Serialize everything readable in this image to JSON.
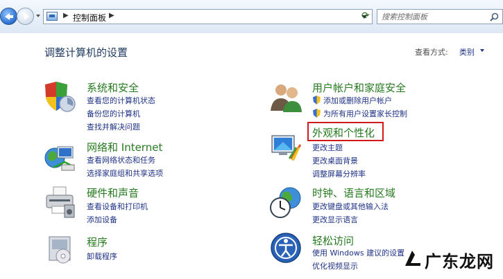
{
  "nav": {
    "breadcrumb": "控制面板",
    "search_placeholder": "搜索控制面板"
  },
  "header": {
    "title": "调整计算机的设置",
    "view_by_label": "查看方式:",
    "view_by_value": "类别"
  },
  "categories": [
    {
      "title": "系统和安全",
      "icon": "shield-icon",
      "links": [
        "查看您的计算机状态",
        "备份您的计算机",
        "查找并解决问题"
      ]
    },
    {
      "title": "网络和 Internet",
      "icon": "network-globe-icon",
      "links": [
        "查看网络状态和任务",
        "选择家庭组和共享选项"
      ]
    },
    {
      "title": "硬件和声音",
      "icon": "printer-icon",
      "links": [
        "查看设备和打印机",
        "添加设备"
      ]
    },
    {
      "title": "程序",
      "icon": "programs-box-icon",
      "links": [
        "卸载程序"
      ]
    },
    {
      "title": "用户帐户和家庭安全",
      "icon": "users-icon",
      "links": [
        "添加或删除用户帐户",
        "为所有用户设置家长控制"
      ]
    },
    {
      "title": "外观和个性化",
      "icon": "appearance-monitor-icon",
      "links": [
        "更改主题",
        "更改桌面背景",
        "调整屏幕分辨率"
      ]
    },
    {
      "title": "时钟、语言和区域",
      "icon": "clock-globe-icon",
      "links": [
        "更改键盘或其他输入法",
        "更改显示语言"
      ]
    },
    {
      "title": "轻松访问",
      "icon": "ease-of-access-icon",
      "links": [
        "使用 Windows 建议的设置",
        "优化视频显示"
      ]
    }
  ],
  "watermark": {
    "text": "广东龙网"
  },
  "colors": {
    "category_title": "#267a1f",
    "link": "#1e3287",
    "highlight": "#d21a1a"
  }
}
